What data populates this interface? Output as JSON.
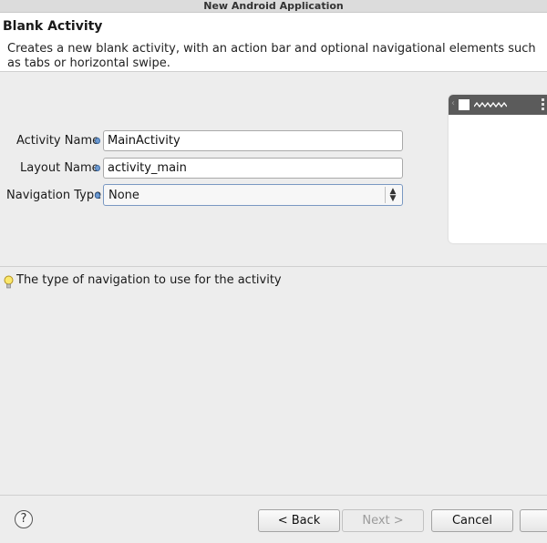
{
  "window": {
    "title": "New Android Application"
  },
  "header": {
    "title": "Blank Activity",
    "description": "Creates a new blank activity, with an action bar and optional navigational elements such as tabs or horizontal swipe."
  },
  "form": {
    "activity_name": {
      "label": "Activity Name",
      "value": "MainActivity"
    },
    "layout_name": {
      "label": "Layout Name",
      "value": "activity_main"
    },
    "navigation_type": {
      "label": "Navigation Type",
      "value": "None"
    }
  },
  "hint": {
    "text": "The type of navigation to use for the activity",
    "icon": "lightbulb-icon"
  },
  "footer": {
    "help": "?",
    "back": "< Back",
    "next": "Next >",
    "cancel": "Cancel"
  },
  "colors": {
    "accent": "#6f9bd1",
    "preview_bar": "#5b5b5b"
  }
}
